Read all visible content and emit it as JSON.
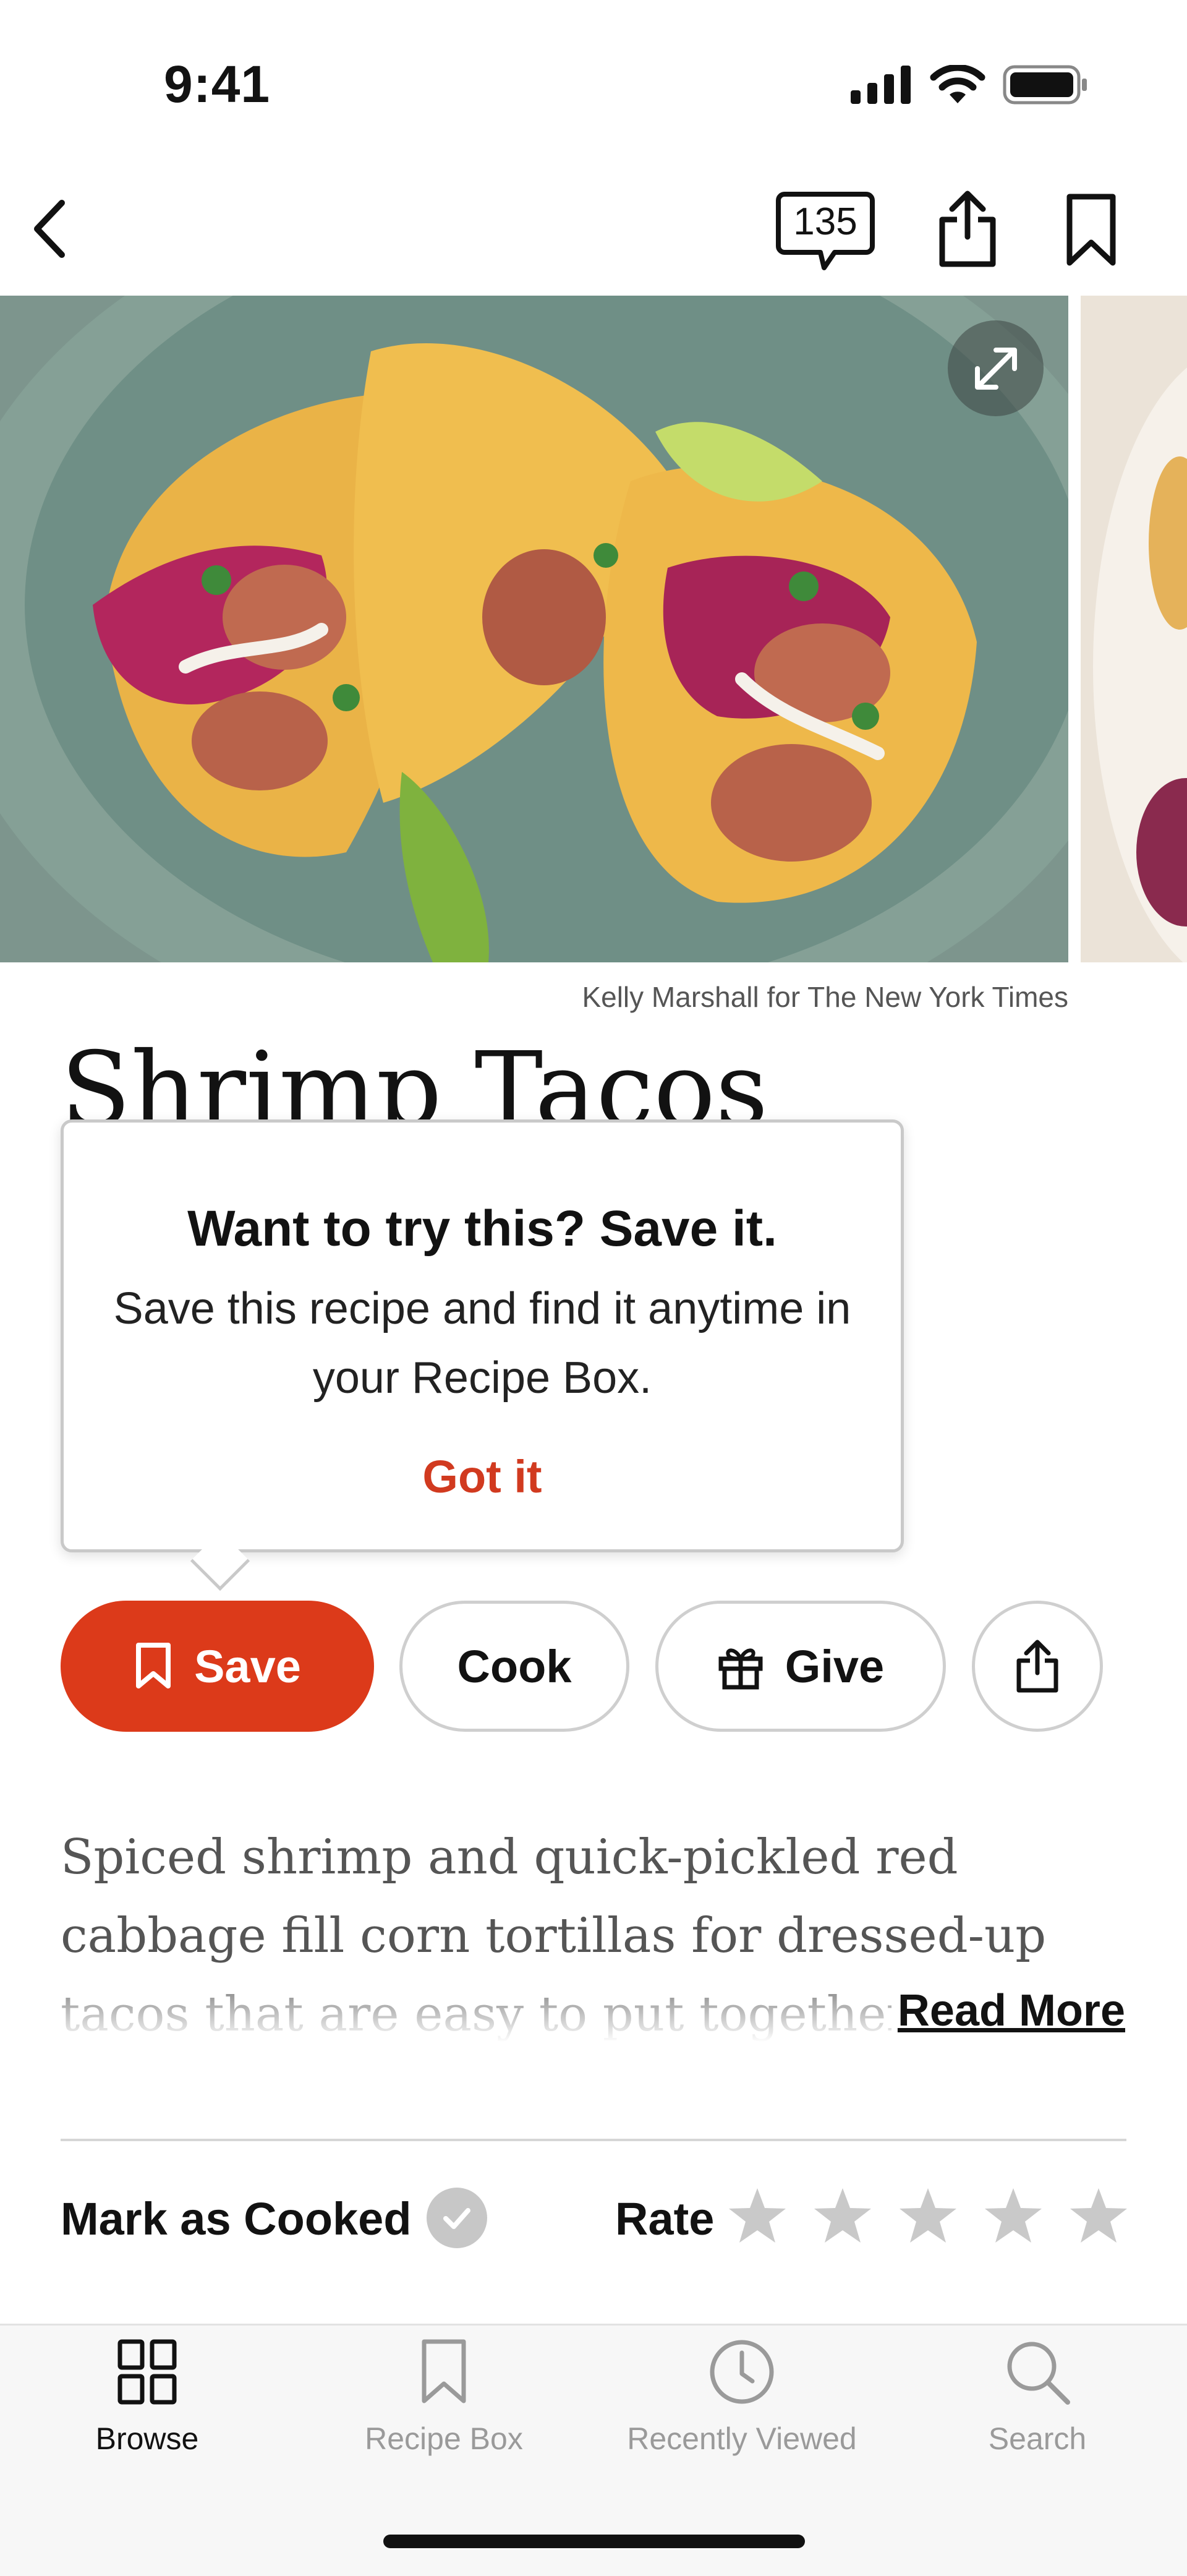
{
  "status_bar": {
    "time": "9:41"
  },
  "nav": {
    "comment_count": "135"
  },
  "hero": {
    "credit": "Kelly Marshall for The New York Times"
  },
  "recipe": {
    "title": "Shrimp Tacos",
    "description": "Spiced shrimp and quick-pickled red cabbage fill corn tortillas for dressed-up tacos that are easy to put together and sure to be a f",
    "read_more": "Read More"
  },
  "tooltip": {
    "heading": "Want to try this? Save it.",
    "body": "Save this recipe and find it anytime in your Recipe Box.",
    "action": "Got it"
  },
  "actions": {
    "save": "Save",
    "cook": "Cook",
    "give": "Give"
  },
  "cooked": {
    "label": "Mark as Cooked"
  },
  "rating": {
    "label": "Rate",
    "stars_total": 5,
    "stars_filled": 0
  },
  "tabs": [
    {
      "label": "Browse",
      "icon": "grid-icon",
      "active": true
    },
    {
      "label": "Recipe Box",
      "icon": "bookmark-icon",
      "active": false
    },
    {
      "label": "Recently Viewed",
      "icon": "clock-icon",
      "active": false
    },
    {
      "label": "Search",
      "icon": "search-icon",
      "active": false
    }
  ],
  "colors": {
    "accent": "#dc3a1a",
    "inactive": "#9a9a9a",
    "star": "#c9c9c9"
  }
}
